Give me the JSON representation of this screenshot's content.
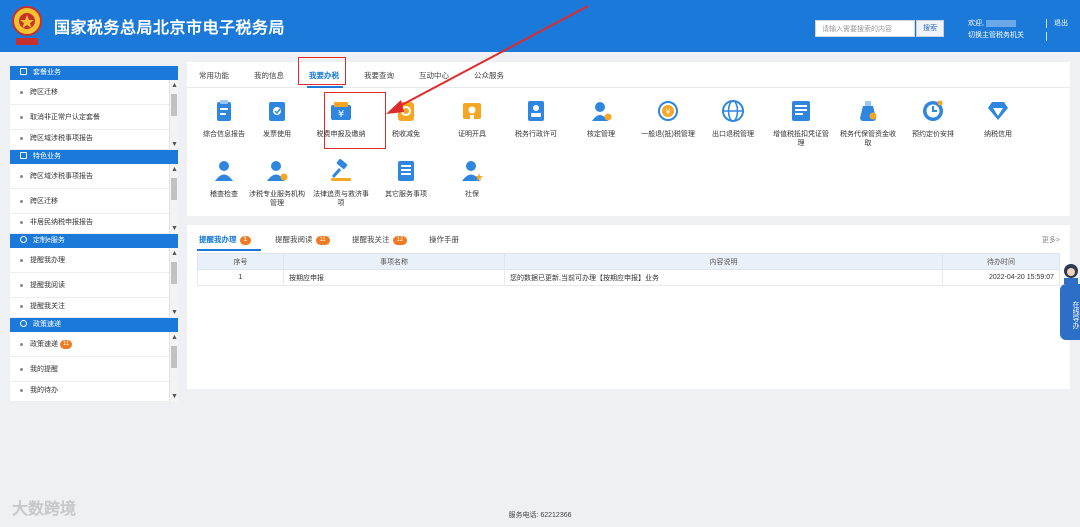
{
  "header": {
    "title": "国家税务总局北京市电子税务局",
    "search_placeholder": "请输入需要搜索的内容",
    "search_button": "搜索",
    "welcome": "欢迎,",
    "switch_org": "切换主管税务机关",
    "logout": "退出"
  },
  "sidebar": {
    "sections": [
      {
        "title": "套餐业务",
        "items": [
          "跨区迁移",
          "取消非正常户认定套餐",
          "跨区域涉税事项报告"
        ]
      },
      {
        "title": "特色业务",
        "items": [
          "跨区域涉税事项报告",
          "跨区迁移",
          "非居民纳税申报报告"
        ]
      },
      {
        "title": "定制e服务",
        "items": [
          "提醒我办理",
          "提醒我阅读",
          "提醒我关注"
        ]
      },
      {
        "title": "政策速递",
        "items": [
          "政策速递",
          "我的提醒",
          "我的待办"
        ],
        "badge": "11"
      }
    ]
  },
  "main": {
    "tabs": [
      "常用功能",
      "我的信息",
      "我要办税",
      "我要查询",
      "互动中心",
      "公众服务"
    ],
    "active_tab": "我要办税",
    "functions": [
      {
        "label": "综合信息报告",
        "icon": "clipboard-icon",
        "color": "#2e86de"
      },
      {
        "label": "发票使用",
        "icon": "invoice-icon",
        "color": "#2e86de"
      },
      {
        "label": "税费申报及缴纳",
        "icon": "wallet-yen-icon",
        "color": "#2e86de"
      },
      {
        "label": "税收减免",
        "icon": "coin-icon",
        "color": "#f5a623"
      },
      {
        "label": "证明开具",
        "icon": "certificate-icon",
        "color": "#f5a623"
      },
      {
        "label": "税务行政许可",
        "icon": "id-card-icon",
        "color": "#2e86de"
      },
      {
        "label": "核定管理",
        "icon": "person-gear-icon",
        "color": "#2e86de"
      },
      {
        "label": "一般退(抵)税管理",
        "icon": "yen-refresh-icon",
        "color": "#f5a623"
      },
      {
        "label": "出口退税管理",
        "icon": "globe-icon",
        "color": "#2e86de"
      },
      {
        "label": "增值税抵扣凭证管理",
        "icon": "receipt-icon",
        "color": "#2e86de"
      },
      {
        "label": "税务代保管资金收取",
        "icon": "money-bag-icon",
        "color": "#2e86de"
      },
      {
        "label": "预约定价安排",
        "icon": "clock-compass-icon",
        "color": "#2e86de"
      },
      {
        "label": "纳税信用",
        "icon": "diamond-icon",
        "color": "#2e86de"
      },
      {
        "label": "稽查检查",
        "icon": "person-icon",
        "color": "#2e86de"
      },
      {
        "label": "涉税专业服务机构管理",
        "icon": "person-badge-icon",
        "color": "#2e86de"
      },
      {
        "label": "法律追责与救济事项",
        "icon": "gavel-icon",
        "color": "#2e86de"
      },
      {
        "label": "其它服务事项",
        "icon": "document-list-icon",
        "color": "#2e86de"
      },
      {
        "label": "社保",
        "icon": "person-star-icon",
        "color": "#2e86de"
      }
    ]
  },
  "lower": {
    "tabs": [
      {
        "label": "提醒我办理",
        "badge": "1"
      },
      {
        "label": "提醒我阅读",
        "badge": "11"
      },
      {
        "label": "提醒我关注",
        "badge": "12"
      },
      {
        "label": "操作手册",
        "badge": ""
      }
    ],
    "more": "更多>",
    "columns": [
      "序号",
      "事项名称",
      "内容说明",
      "待办时间"
    ],
    "rows": [
      [
        "1",
        "按期应申报",
        "您的数据已更新,当前可办理【按期应申报】业务",
        "2022-04-20 15:59:07"
      ]
    ]
  },
  "float_nav": "在线导办",
  "footer": "服务电话: 62212366",
  "watermark": "大数跨境",
  "colors": {
    "brand": "#1b79d9",
    "highlight": "#e02b2b",
    "badge": "#ef7a22"
  }
}
